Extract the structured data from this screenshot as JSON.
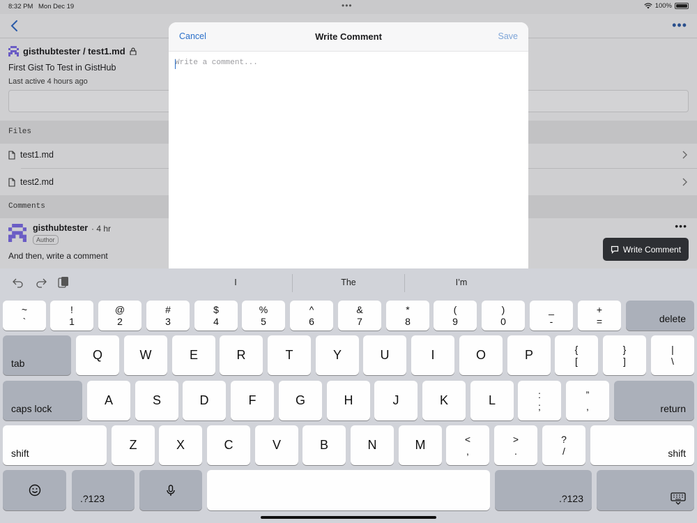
{
  "status_bar": {
    "time": "8:32 PM",
    "date": "Mon Dec 19",
    "battery": "100%"
  },
  "gist": {
    "owner_repo": "gisthubtester / test1.md",
    "description": "First Gist To Test in GistHub",
    "last_active": "Last active 4 hours ago"
  },
  "files_section": {
    "header": "Files",
    "files": [
      "test1.md",
      "test2.md"
    ]
  },
  "comments_section": {
    "header": "Comments",
    "comment": {
      "author": "gisthubtester",
      "time": "· 4 hr",
      "badge": "Author",
      "body": "And then, write a comment"
    }
  },
  "fab": {
    "label": "Write Comment"
  },
  "sheet": {
    "title": "Write Comment",
    "cancel_label": "Cancel",
    "save_label": "Save",
    "placeholder": "Write a comment..."
  },
  "keyboard": {
    "suggestions": [
      "I",
      "The",
      "I’m"
    ],
    "row1": [
      [
        "~",
        "`"
      ],
      [
        "!",
        "1"
      ],
      [
        "@",
        "2"
      ],
      [
        "#",
        "3"
      ],
      [
        "$",
        "4"
      ],
      [
        "%",
        "5"
      ],
      [
        "^",
        "6"
      ],
      [
        "&",
        "7"
      ],
      [
        "*",
        "8"
      ],
      [
        "(",
        "9"
      ],
      [
        ")",
        "0"
      ],
      [
        "_",
        "-"
      ],
      [
        "+",
        "="
      ]
    ],
    "delete": "delete",
    "tab": "tab",
    "row2": [
      "Q",
      "W",
      "E",
      "R",
      "T",
      "Y",
      "U",
      "I",
      "O",
      "P"
    ],
    "row2_extra": [
      [
        "{",
        "["
      ],
      [
        "}",
        "]"
      ],
      [
        "|",
        "\\"
      ]
    ],
    "caps_lock": "caps lock",
    "row3": [
      "A",
      "S",
      "D",
      "F",
      "G",
      "H",
      "J",
      "K",
      "L"
    ],
    "row3_extra": [
      [
        ":",
        ";"
      ],
      [
        "”",
        ","
      ]
    ],
    "return": "return",
    "shift": "shift",
    "row4": [
      "Z",
      "X",
      "C",
      "V",
      "B",
      "N",
      "M"
    ],
    "row4_extra": [
      [
        "<",
        ","
      ],
      [
        ">",
        "."
      ],
      [
        "?",
        "/"
      ]
    ],
    "numbers_toggle": ".?123"
  }
}
